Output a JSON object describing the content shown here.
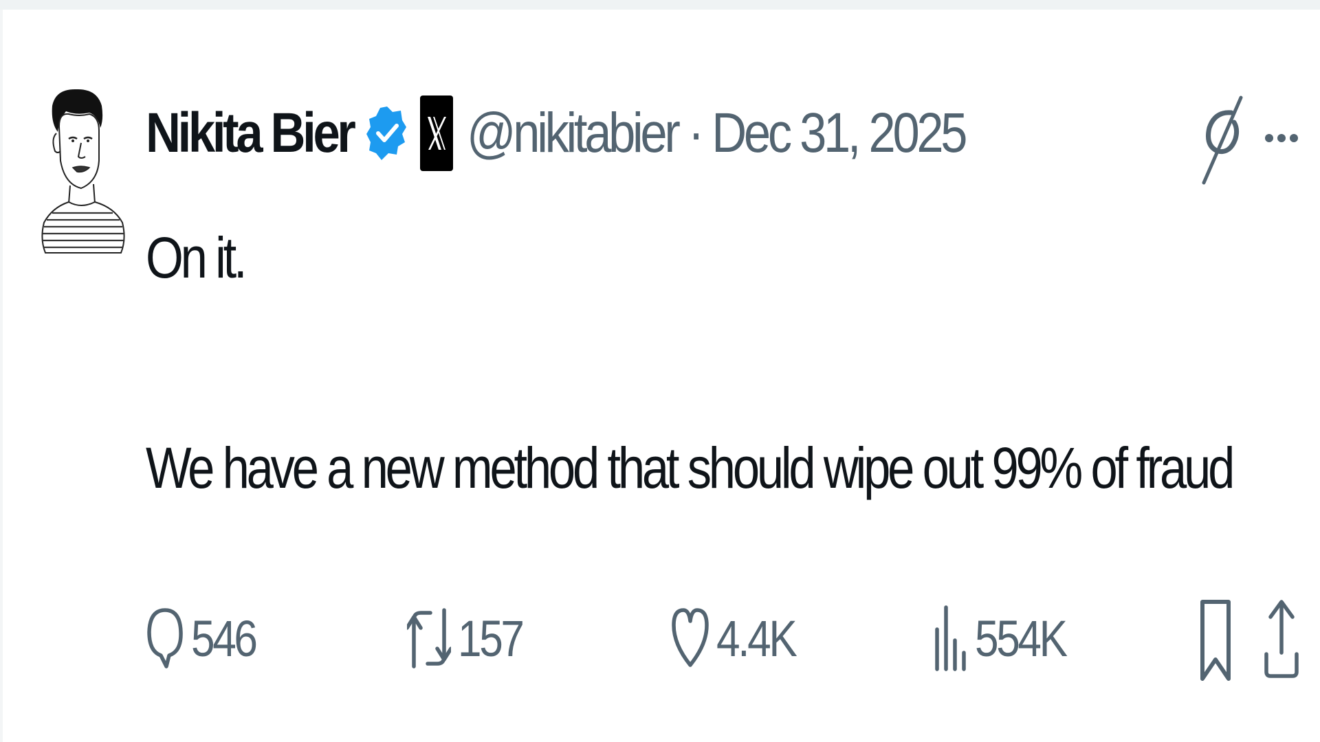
{
  "author": {
    "name": "Nikita Bier",
    "handle": "@nikitabier",
    "separator": "·",
    "date": "Dec 31, 2025",
    "verified": true,
    "affiliate_badge": "X"
  },
  "tweet": {
    "text_line1": "On it.",
    "text_line2": "",
    "text_line3": "We have a new method that should wipe out 99% of fraud"
  },
  "actions": {
    "replies": "546",
    "reposts": "157",
    "likes": "4.4K",
    "views": "554K"
  },
  "colors": {
    "text_primary": "#0f1419",
    "text_secondary": "#536471",
    "verified_blue": "#1d9bf0"
  },
  "icons": {
    "header": [
      "grok-icon",
      "more-icon"
    ],
    "actions": [
      "reply-icon",
      "repost-icon",
      "like-icon",
      "views-icon",
      "bookmark-icon",
      "share-icon"
    ]
  }
}
